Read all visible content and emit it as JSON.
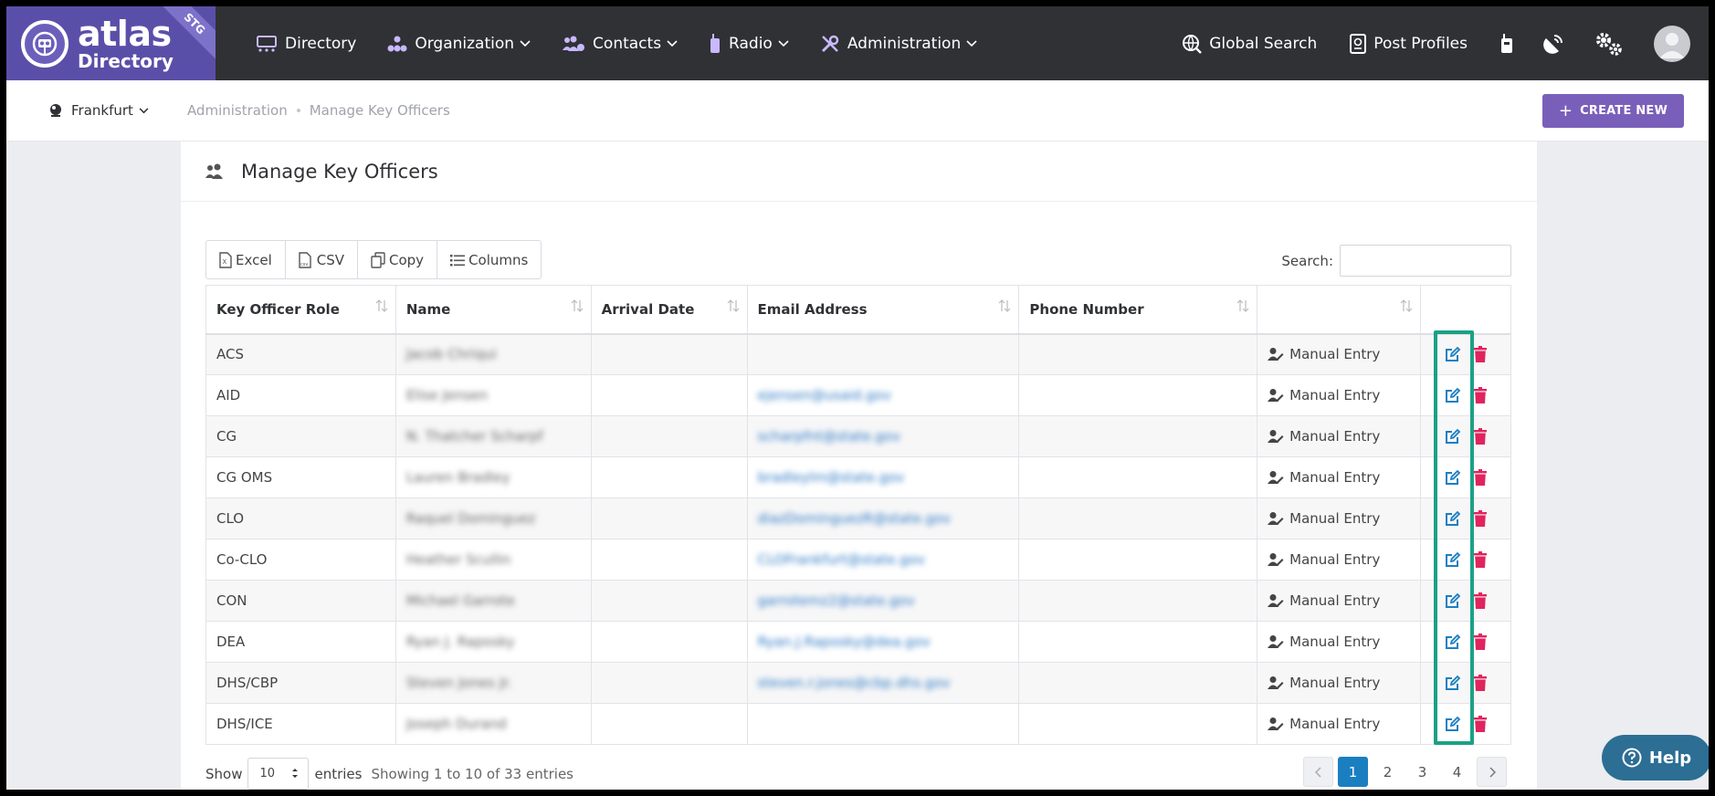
{
  "brand": {
    "line1": "atlas",
    "line2": "Directory",
    "env_badge": "STG"
  },
  "nav": {
    "items": [
      {
        "label": "Directory",
        "icon": "directory-icon",
        "dropdown": false
      },
      {
        "label": "Organization",
        "icon": "org-chart-icon",
        "dropdown": true
      },
      {
        "label": "Contacts",
        "icon": "contacts-icon",
        "dropdown": true
      },
      {
        "label": "Radio",
        "icon": "radio-icon",
        "dropdown": true
      },
      {
        "label": "Administration",
        "icon": "tools-icon",
        "dropdown": true
      }
    ],
    "right": [
      {
        "label": "Global Search",
        "icon": "globe-search-icon"
      },
      {
        "label": "Post Profiles",
        "icon": "passport-icon"
      }
    ]
  },
  "subheader": {
    "city": "Frankfurt",
    "breadcrumb": [
      "Administration",
      "Manage Key Officers"
    ],
    "create_label": "CREATE NEW"
  },
  "page": {
    "title": "Manage Key Officers"
  },
  "toolbar": {
    "excel": "Excel",
    "csv": "CSV",
    "copy": "Copy",
    "columns": "Columns"
  },
  "search": {
    "label": "Search:",
    "value": ""
  },
  "table": {
    "headers": [
      "Key Officer Role",
      "Name",
      "Arrival Date",
      "Email Address",
      "Phone Number",
      ""
    ],
    "rows": [
      {
        "role": "ACS",
        "name": "Jacob Chriqui",
        "arrival": "",
        "email": "",
        "phone": "",
        "source": "Manual Entry"
      },
      {
        "role": "AID",
        "name": "Elise Jensen",
        "arrival": "",
        "email": "ejensen@usaid.gov",
        "phone": "",
        "source": "Manual Entry"
      },
      {
        "role": "CG",
        "name": "N. Thatcher Scharpf",
        "arrival": "",
        "email": "scharpfnt@state.gov",
        "phone": "",
        "source": "Manual Entry"
      },
      {
        "role": "CG OMS",
        "name": "Lauren Bradley",
        "arrival": "",
        "email": "bradleylm@state.gov",
        "phone": "",
        "source": "Manual Entry"
      },
      {
        "role": "CLO",
        "name": "Raquel Dominguez",
        "arrival": "",
        "email": "diazDominguezR@state.gov",
        "phone": "",
        "source": "Manual Entry"
      },
      {
        "role": "Co-CLO",
        "name": "Heather Scullin",
        "arrival": "",
        "email": "CLOFrankfurt@state.gov",
        "phone": "",
        "source": "Manual Entry"
      },
      {
        "role": "CON",
        "name": "Michael Garrote",
        "arrival": "",
        "email": "garrotemz2@state.gov",
        "phone": "",
        "source": "Manual Entry"
      },
      {
        "role": "DEA",
        "name": "Ryan J. Raposky",
        "arrival": "",
        "email": "Ryan.J.Raposky@dea.gov",
        "phone": "",
        "source": "Manual Entry"
      },
      {
        "role": "DHS/CBP",
        "name": "Steven Jones Jr.",
        "arrival": "",
        "email": "steven.r.jones@cbp.dhs.gov",
        "phone": "",
        "source": "Manual Entry"
      },
      {
        "role": "DHS/ICE",
        "name": "Joseph Durand",
        "arrival": "",
        "email": "",
        "phone": "",
        "source": "Manual Entry"
      }
    ]
  },
  "footer": {
    "show": "Show",
    "page_size": "10",
    "entries": "entries",
    "info": "Showing 1 to 10 of 33 entries",
    "pages": [
      "1",
      "2",
      "3",
      "4"
    ],
    "current_page": "1"
  },
  "help": {
    "label": "Help"
  },
  "colors": {
    "nav_bg": "#2f3135",
    "brand": "#5a4fa8",
    "create_button": "#7a5fba",
    "edit_icon": "#1a7fc1",
    "delete_icon": "#e0245e",
    "highlight": "#1aa184",
    "active_page": "#1a7fc1",
    "help_button": "#2c6e94"
  }
}
